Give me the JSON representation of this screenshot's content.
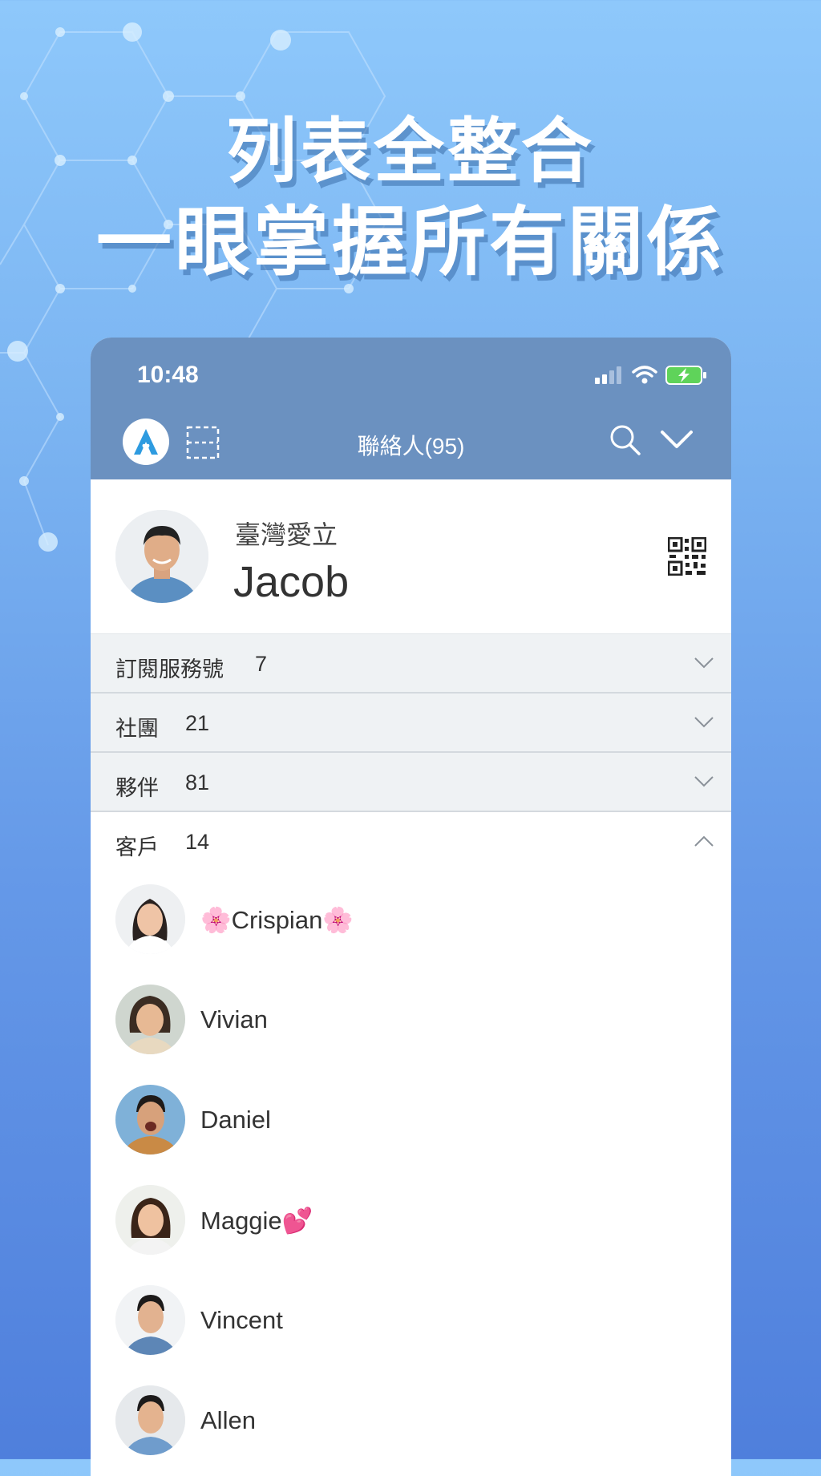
{
  "headline": {
    "line1": "列表全整合",
    "line2": "一眼掌握所有關係"
  },
  "status_bar": {
    "time": "10:48"
  },
  "app_bar": {
    "title": "聯絡人(95)"
  },
  "profile": {
    "company": "臺灣愛立",
    "name": "Jacob"
  },
  "groups": [
    {
      "label": "訂閱服務號",
      "count": "7",
      "expanded": false
    },
    {
      "label": "社團",
      "count": "21",
      "expanded": false
    },
    {
      "label": "夥伴",
      "count": "81",
      "expanded": false
    },
    {
      "label": "客戶",
      "count": "14",
      "expanded": true
    }
  ],
  "contacts": [
    {
      "name": "🌸Crispian🌸"
    },
    {
      "name": "Vivian"
    },
    {
      "name": "Daniel"
    },
    {
      "name": "Maggie💕"
    },
    {
      "name": "Vincent"
    },
    {
      "name": "Allen"
    }
  ],
  "colors": {
    "header": "#6b91c0",
    "group_bg": "#eff2f4",
    "battery": "#5fd35a"
  }
}
